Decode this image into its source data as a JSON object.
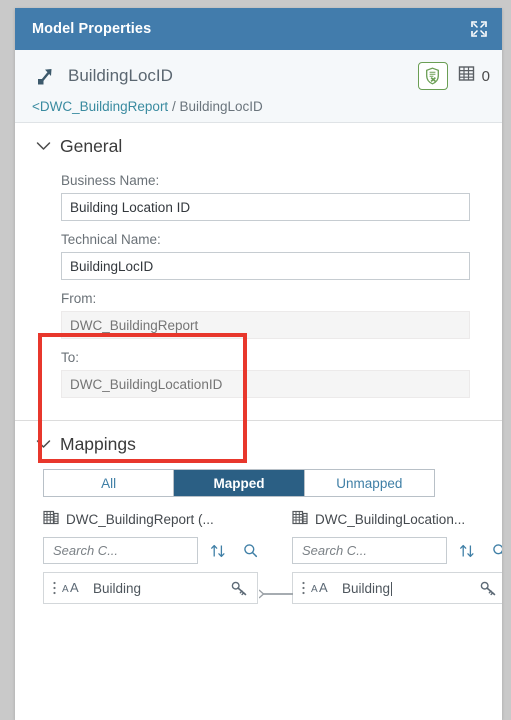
{
  "titlebar": {
    "title": "Model Properties",
    "expand_icon": "expand-fullscreen-icon"
  },
  "object_header": {
    "icon": "association-arrow-icon",
    "name": "BuildingLocID",
    "shield_icon": "shield-validation-icon",
    "grid_icon": "table-grid-icon",
    "grid_count": "0",
    "breadcrumb": {
      "parent_link": "<DWC_BuildingReport",
      "separator": " / ",
      "current": "BuildingLocID"
    }
  },
  "general": {
    "title": "General",
    "chevron_icon": "chevron-down-icon",
    "fields": [
      {
        "label": "Business Name:",
        "value": "Building Location ID",
        "placeholder": "",
        "readonly": false
      },
      {
        "label": "Technical Name:",
        "value": "BuildingLocID",
        "placeholder": "",
        "readonly": false
      },
      {
        "label": "From:",
        "value": "DWC_BuildingReport",
        "placeholder": "DWC_BuildingReport",
        "readonly": true
      },
      {
        "label": "To:",
        "value": "DWC_BuildingLocationID",
        "placeholder": "DWC_BuildingLocationID",
        "readonly": true
      }
    ]
  },
  "mappings": {
    "title": "Mappings",
    "chevron_icon": "chevron-down-icon",
    "filter_tabs": [
      {
        "label": "All",
        "selected": false
      },
      {
        "label": "Mapped",
        "selected": true
      },
      {
        "label": "Unmapped",
        "selected": false
      }
    ],
    "source": {
      "icon": "entity-table-icon",
      "header": "DWC_BuildingReport (...",
      "search_placeholder": "Search C...",
      "search_value": "",
      "search_icon": "search-magnifier-icon",
      "sort_icon": "sort-ascending-descending-icon",
      "item": {
        "grip_icon": "drag-grip-dots-icon",
        "type_icon": "aa-text-type-icon",
        "label": "Building",
        "action_icon": "key-icon"
      }
    },
    "target": {
      "icon": "entity-table-icon",
      "header": "DWC_BuildingLocation...",
      "search_placeholder": "Search C...",
      "search_value": "",
      "search_icon": "search-magnifier-icon",
      "sort_icon": "sort-ascending-descending-icon",
      "item": {
        "grip_icon": "drag-grip-dots-icon",
        "type_icon": "aa-text-type-icon",
        "label": "Building",
        "action_icon": "key-icon"
      }
    },
    "connector_icon": "mapping-connector-line"
  },
  "annotation": {
    "highlight_color": "#e8372c",
    "highlight_target": "from-to-fields"
  },
  "colors": {
    "titlebar_bg": "#427cac",
    "accent_link": "#3a8ba0",
    "segment_active_bg": "#2b5f84",
    "shield_border": "#6a9e54"
  }
}
